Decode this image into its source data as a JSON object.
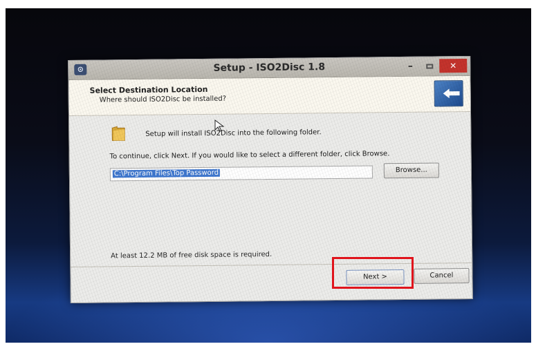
{
  "window": {
    "title": "Setup - ISO2Disc 1.8",
    "minimize_glyph": "–",
    "close_glyph": "✕",
    "app_icon_glyph": "⊙"
  },
  "header": {
    "title": "Select Destination Location",
    "subtitle": "Where should ISO2Disc be installed?"
  },
  "content": {
    "intro_text": "Setup will install ISO2Disc into the following folder.",
    "continue_text": "To continue, click Next. If you would like to select a different folder, click Browse.",
    "install_path": "C:\\Program Files\\Top Password",
    "browse_label": "Browse...",
    "disk_space_text": "At least 12.2 MB of free disk space is required."
  },
  "footer": {
    "next_label": "Next >",
    "cancel_label": "Cancel"
  },
  "colors": {
    "highlight": "#e0141c",
    "selection": "#3f78cf",
    "close_button": "#c4332c"
  },
  "icons": [
    "app-icon",
    "minimize-icon",
    "maximize-icon",
    "close-icon",
    "folder-icon",
    "wizard-image",
    "mouse-cursor-icon"
  ]
}
